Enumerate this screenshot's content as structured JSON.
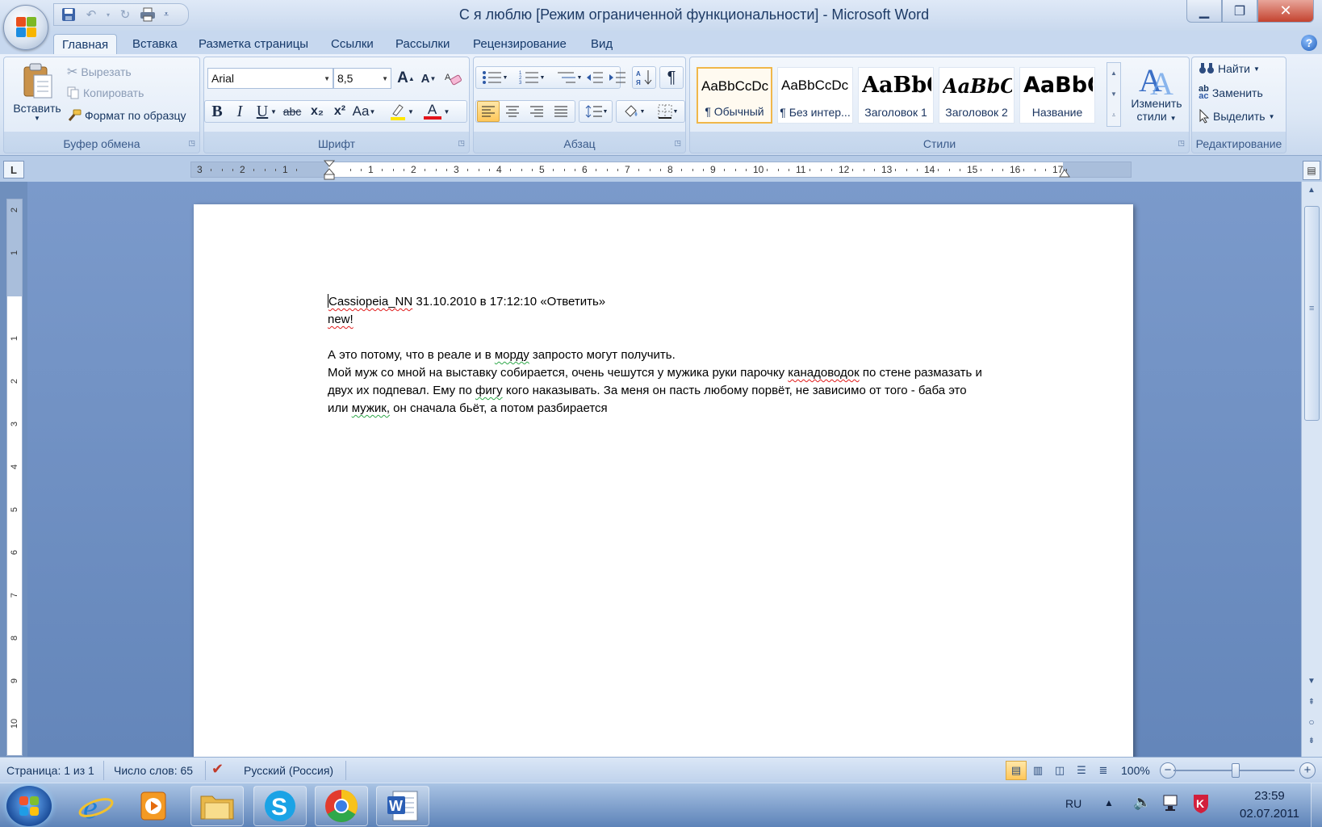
{
  "window": {
    "title": "С я люблю [Режим ограниченной функциональности] - Microsoft Word"
  },
  "tabs": [
    "Главная",
    "Вставка",
    "Разметка страницы",
    "Ссылки",
    "Рассылки",
    "Рецензирование",
    "Вид"
  ],
  "clipboard": {
    "paste": "Вставить",
    "cut": "Вырезать",
    "copy": "Копировать",
    "format_painter": "Формат по образцу",
    "label": "Буфер обмена"
  },
  "font": {
    "family": "Arial",
    "size": "8,5",
    "label": "Шрифт",
    "bold": "B",
    "italic": "I",
    "underline": "U",
    "strike": "abc",
    "subscript": "x₂",
    "superscript": "x²",
    "change_case": "Aa",
    "grow": "A",
    "shrink": "A",
    "font_color_letter": "A"
  },
  "paragraph": {
    "label": "Абзац",
    "pilcrow": "¶"
  },
  "styles": {
    "label": "Стили",
    "items": [
      {
        "sample": "AaBbCcDc",
        "name": "¶ Обычный"
      },
      {
        "sample": "AaBbCcDc",
        "name": "¶ Без интер..."
      },
      {
        "sample": "AaBbC",
        "name": "Заголовок 1"
      },
      {
        "sample": "AaBbCc",
        "name": "Заголовок 2"
      },
      {
        "sample": "AaBbC",
        "name": "Название"
      }
    ],
    "change_styles_line1": "Изменить",
    "change_styles_line2": "стили"
  },
  "editing": {
    "label": "Редактирование",
    "find": "Найти",
    "replace": "Заменить",
    "select": "Выделить"
  },
  "ruler": {
    "labels": [
      "3",
      "2",
      "1",
      "1",
      "2",
      "3",
      "4",
      "5",
      "6",
      "7",
      "8",
      "9",
      "10",
      "11",
      "12",
      "13",
      "14",
      "15",
      "16",
      "17"
    ],
    "corner": "L"
  },
  "vruler": {
    "labels": [
      "2",
      "1",
      "1",
      "2",
      "3",
      "4",
      "5",
      "6",
      "7",
      "8",
      "9",
      "10"
    ]
  },
  "document": {
    "line1_user": "Cassiopeia_NN",
    "line1_rest": " 31.10.2010  в 17:12:10  «Ответить»",
    "line2": "new!",
    "line4_a": "А это потому, что в реале и в ",
    "line4_b": "морду",
    "line4_c": " запросто могут получить.",
    "line5_a": "Мой муж со мной на выставку собирается, очень чешутся у мужика руки парочку ",
    "line5_b": "канадоводок",
    "line5_c": "  по стене размазать  и",
    "line6_a": "двух их подпевал.  Ему по ",
    "line6_b": "фигу",
    "line6_c": " кого наказывать.  За меня он пасть любому порвёт,  не зависимо от того  - баба это",
    "line7_a": "или ",
    "line7_b": "мужик,",
    "line7_c": " он сначала бьёт, а потом  разбирается"
  },
  "status": {
    "page": "Страница: 1 из 1",
    "words": "Число слов: 65",
    "language": "Русский (Россия)",
    "zoom": "100%"
  },
  "taskbar": {
    "lang": "RU",
    "time": "23:59",
    "date": "02.07.2011"
  }
}
